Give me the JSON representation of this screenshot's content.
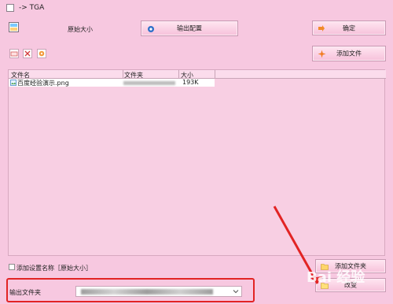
{
  "window": {
    "title": "-> TGA"
  },
  "top": {
    "size_label": "原始大小",
    "output_config_label": "输出配置",
    "confirm_label": "确定",
    "add_file_label": "添加文件"
  },
  "filelist": {
    "columns": [
      "文件名",
      "文件夹",
      "大小"
    ],
    "rows": [
      {
        "name": "百度经验演示.png",
        "size": "193K"
      }
    ]
  },
  "bottom": {
    "add_setting_name_label": "添加设置名称［原始大小］",
    "output_folder_label": "输出文件夹",
    "add_folder_label": "添加文件夹",
    "change_label": "改变"
  },
  "watermark": {
    "text": "Bai 经验"
  }
}
